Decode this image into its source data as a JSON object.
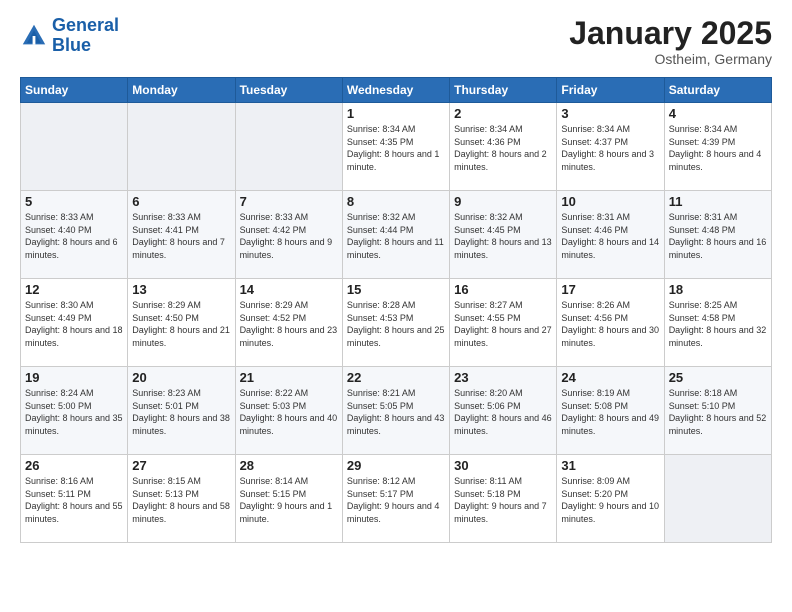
{
  "header": {
    "logo_line1": "General",
    "logo_line2": "Blue",
    "month": "January 2025",
    "location": "Ostheim, Germany"
  },
  "weekdays": [
    "Sunday",
    "Monday",
    "Tuesday",
    "Wednesday",
    "Thursday",
    "Friday",
    "Saturday"
  ],
  "weeks": [
    [
      {
        "day": "",
        "text": "",
        "empty": true
      },
      {
        "day": "",
        "text": "",
        "empty": true
      },
      {
        "day": "",
        "text": "",
        "empty": true
      },
      {
        "day": "1",
        "text": "Sunrise: 8:34 AM\nSunset: 4:35 PM\nDaylight: 8 hours\nand 1 minute."
      },
      {
        "day": "2",
        "text": "Sunrise: 8:34 AM\nSunset: 4:36 PM\nDaylight: 8 hours\nand 2 minutes."
      },
      {
        "day": "3",
        "text": "Sunrise: 8:34 AM\nSunset: 4:37 PM\nDaylight: 8 hours\nand 3 minutes."
      },
      {
        "day": "4",
        "text": "Sunrise: 8:34 AM\nSunset: 4:39 PM\nDaylight: 8 hours\nand 4 minutes."
      }
    ],
    [
      {
        "day": "5",
        "text": "Sunrise: 8:33 AM\nSunset: 4:40 PM\nDaylight: 8 hours\nand 6 minutes."
      },
      {
        "day": "6",
        "text": "Sunrise: 8:33 AM\nSunset: 4:41 PM\nDaylight: 8 hours\nand 7 minutes."
      },
      {
        "day": "7",
        "text": "Sunrise: 8:33 AM\nSunset: 4:42 PM\nDaylight: 8 hours\nand 9 minutes."
      },
      {
        "day": "8",
        "text": "Sunrise: 8:32 AM\nSunset: 4:44 PM\nDaylight: 8 hours\nand 11 minutes."
      },
      {
        "day": "9",
        "text": "Sunrise: 8:32 AM\nSunset: 4:45 PM\nDaylight: 8 hours\nand 13 minutes."
      },
      {
        "day": "10",
        "text": "Sunrise: 8:31 AM\nSunset: 4:46 PM\nDaylight: 8 hours\nand 14 minutes."
      },
      {
        "day": "11",
        "text": "Sunrise: 8:31 AM\nSunset: 4:48 PM\nDaylight: 8 hours\nand 16 minutes."
      }
    ],
    [
      {
        "day": "12",
        "text": "Sunrise: 8:30 AM\nSunset: 4:49 PM\nDaylight: 8 hours\nand 18 minutes."
      },
      {
        "day": "13",
        "text": "Sunrise: 8:29 AM\nSunset: 4:50 PM\nDaylight: 8 hours\nand 21 minutes."
      },
      {
        "day": "14",
        "text": "Sunrise: 8:29 AM\nSunset: 4:52 PM\nDaylight: 8 hours\nand 23 minutes."
      },
      {
        "day": "15",
        "text": "Sunrise: 8:28 AM\nSunset: 4:53 PM\nDaylight: 8 hours\nand 25 minutes."
      },
      {
        "day": "16",
        "text": "Sunrise: 8:27 AM\nSunset: 4:55 PM\nDaylight: 8 hours\nand 27 minutes."
      },
      {
        "day": "17",
        "text": "Sunrise: 8:26 AM\nSunset: 4:56 PM\nDaylight: 8 hours\nand 30 minutes."
      },
      {
        "day": "18",
        "text": "Sunrise: 8:25 AM\nSunset: 4:58 PM\nDaylight: 8 hours\nand 32 minutes."
      }
    ],
    [
      {
        "day": "19",
        "text": "Sunrise: 8:24 AM\nSunset: 5:00 PM\nDaylight: 8 hours\nand 35 minutes."
      },
      {
        "day": "20",
        "text": "Sunrise: 8:23 AM\nSunset: 5:01 PM\nDaylight: 8 hours\nand 38 minutes."
      },
      {
        "day": "21",
        "text": "Sunrise: 8:22 AM\nSunset: 5:03 PM\nDaylight: 8 hours\nand 40 minutes."
      },
      {
        "day": "22",
        "text": "Sunrise: 8:21 AM\nSunset: 5:05 PM\nDaylight: 8 hours\nand 43 minutes."
      },
      {
        "day": "23",
        "text": "Sunrise: 8:20 AM\nSunset: 5:06 PM\nDaylight: 8 hours\nand 46 minutes."
      },
      {
        "day": "24",
        "text": "Sunrise: 8:19 AM\nSunset: 5:08 PM\nDaylight: 8 hours\nand 49 minutes."
      },
      {
        "day": "25",
        "text": "Sunrise: 8:18 AM\nSunset: 5:10 PM\nDaylight: 8 hours\nand 52 minutes."
      }
    ],
    [
      {
        "day": "26",
        "text": "Sunrise: 8:16 AM\nSunset: 5:11 PM\nDaylight: 8 hours\nand 55 minutes."
      },
      {
        "day": "27",
        "text": "Sunrise: 8:15 AM\nSunset: 5:13 PM\nDaylight: 8 hours\nand 58 minutes."
      },
      {
        "day": "28",
        "text": "Sunrise: 8:14 AM\nSunset: 5:15 PM\nDaylight: 9 hours\nand 1 minute."
      },
      {
        "day": "29",
        "text": "Sunrise: 8:12 AM\nSunset: 5:17 PM\nDaylight: 9 hours\nand 4 minutes."
      },
      {
        "day": "30",
        "text": "Sunrise: 8:11 AM\nSunset: 5:18 PM\nDaylight: 9 hours\nand 7 minutes."
      },
      {
        "day": "31",
        "text": "Sunrise: 8:09 AM\nSunset: 5:20 PM\nDaylight: 9 hours\nand 10 minutes."
      },
      {
        "day": "",
        "text": "",
        "empty": true
      }
    ]
  ]
}
